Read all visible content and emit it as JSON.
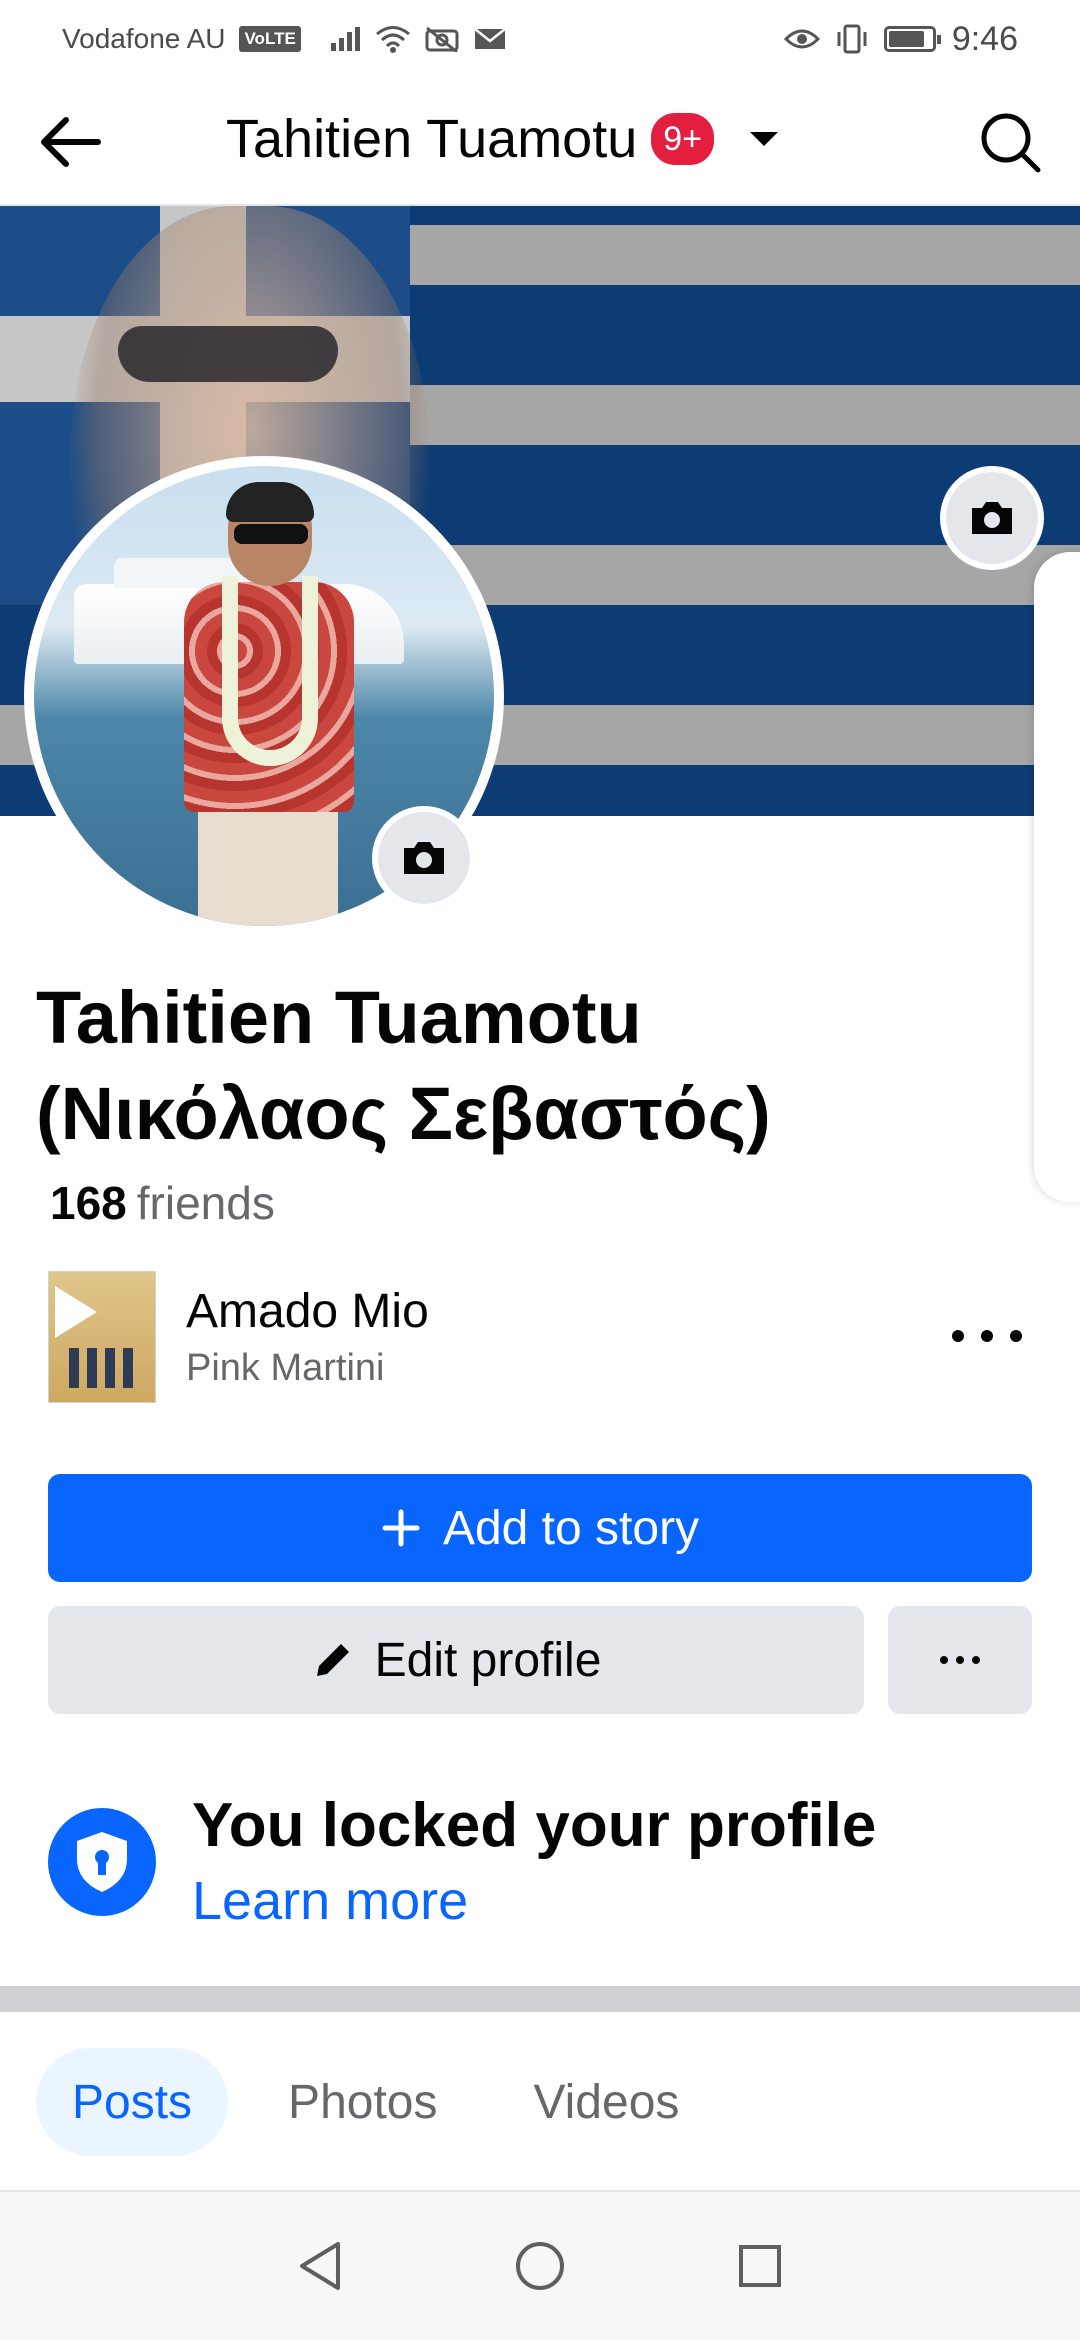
{
  "status_bar": {
    "carrier": "Vodafone AU",
    "volte": "VoLTE",
    "time": "9:46",
    "battery_level": 0.8
  },
  "header": {
    "title": "Tahitien Tuamotu",
    "badge": "9+"
  },
  "colors": {
    "brand_blue": "#0866ff",
    "flag_blue": "#0d3b73",
    "flag_white": "#a6a6a6",
    "badge_red": "#e41e3f"
  },
  "profile": {
    "name_line1": "Tahitien Tuamotu",
    "name_line2": "(Νικόλαος Σεβαστός)",
    "friends_count": "168",
    "friends_label": "friends"
  },
  "music": {
    "song": "Amado Mio",
    "artist": "Pink Martini"
  },
  "actions": {
    "add_story": "Add to story",
    "edit_profile": "Edit profile"
  },
  "lock": {
    "title": "You locked your profile",
    "link": "Learn more"
  },
  "tabs": [
    {
      "label": "Posts",
      "active": true
    },
    {
      "label": "Photos",
      "active": false
    },
    {
      "label": "Videos",
      "active": false
    }
  ]
}
